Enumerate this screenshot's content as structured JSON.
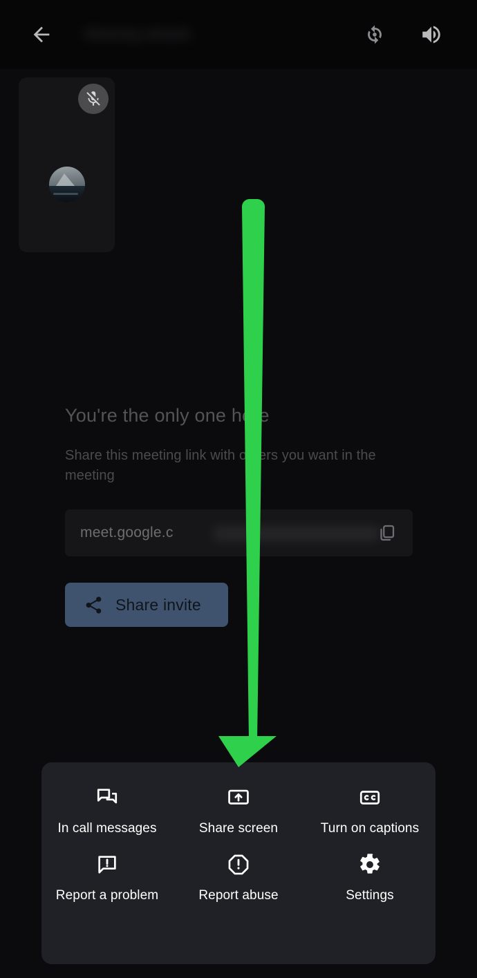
{
  "app": {
    "screen_name": "Google Meet in-call menu",
    "background_color": "#0b0b0d"
  },
  "topbar": {
    "back_label": "Back",
    "back_icon": "arrow-left-icon",
    "meeting_title": "Meeting details",
    "flip_camera_icon": "flip-camera-icon",
    "flip_camera_label": "Switch camera",
    "speaker_icon": "speaker-volume-icon",
    "speaker_label": "Speaker"
  },
  "self_view": {
    "mic_status": "muted",
    "mic_icon": "mic-off-icon",
    "avatar_name": "avatar",
    "badge_color": "#4b4b4d",
    "tile_color": "#151518"
  },
  "empty_state": {
    "title": "You're the only one here",
    "subtitle": "Share this meeting link with others you want in the meeting",
    "link_value": "meet.google.c",
    "link_redacted": true,
    "copy_icon": "copy-icon",
    "copy_label": "Copy meeting link",
    "share_button_label": "Share invite",
    "share_icon": "share-icon",
    "share_button_color": "#3f536f"
  },
  "bottom_sheet": {
    "background_color": "#202126",
    "items": [
      {
        "label": "In call messages",
        "icon": "chat-bubbles-icon"
      },
      {
        "label": "Share screen",
        "icon": "screen-share-icon"
      },
      {
        "label": "Turn on captions",
        "icon": "closed-captions-icon"
      },
      {
        "label": "Report a problem",
        "icon": "feedback-icon"
      },
      {
        "label": "Report abuse",
        "icon": "report-abuse-icon"
      },
      {
        "label": "Settings",
        "icon": "gear-icon"
      }
    ]
  },
  "annotation": {
    "type": "arrow",
    "direction": "down",
    "color": "#2fd04b",
    "points_to": "Share screen"
  }
}
